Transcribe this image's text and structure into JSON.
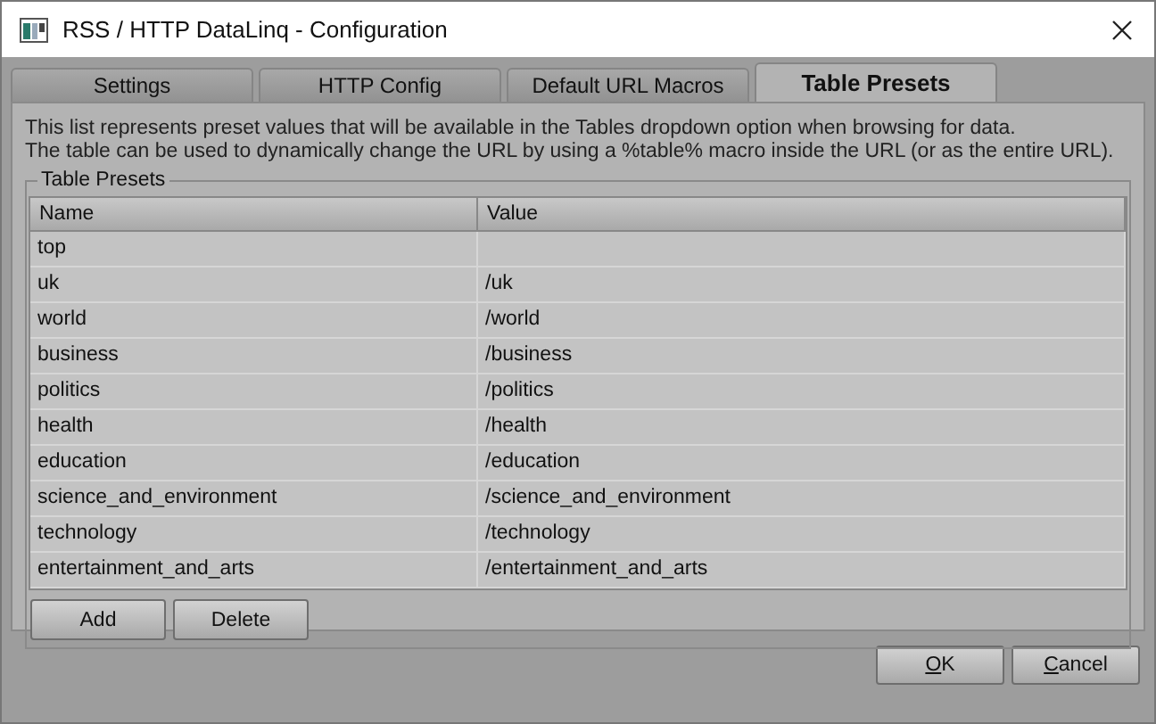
{
  "window": {
    "title": "RSS / HTTP DataLinq - Configuration"
  },
  "tabs": [
    {
      "label": "Settings",
      "selected": false
    },
    {
      "label": "HTTP Config",
      "selected": false
    },
    {
      "label": "Default URL Macros",
      "selected": false
    },
    {
      "label": "Table Presets",
      "selected": true
    }
  ],
  "description": [
    "This list represents preset values that will be available in the Tables dropdown option when browsing for data.",
    "The table can be used to dynamically change the URL by using a %table% macro inside the URL (or as the entire URL)."
  ],
  "group": {
    "title": "Table Presets",
    "table": {
      "columns": [
        "Name",
        "Value"
      ],
      "rows": [
        [
          "top",
          ""
        ],
        [
          "uk",
          "/uk"
        ],
        [
          "world",
          "/world"
        ],
        [
          "business",
          "/business"
        ],
        [
          "politics",
          "/politics"
        ],
        [
          "health",
          "/health"
        ],
        [
          "education",
          "/education"
        ],
        [
          "science_and_environment",
          "/science_and_environment"
        ],
        [
          "technology",
          "/technology"
        ],
        [
          "entertainment_and_arts",
          "/entertainment_and_arts"
        ]
      ]
    },
    "buttons": [
      "Add",
      "Delete"
    ]
  },
  "dialog_buttons": [
    "OK",
    "Cancel"
  ]
}
